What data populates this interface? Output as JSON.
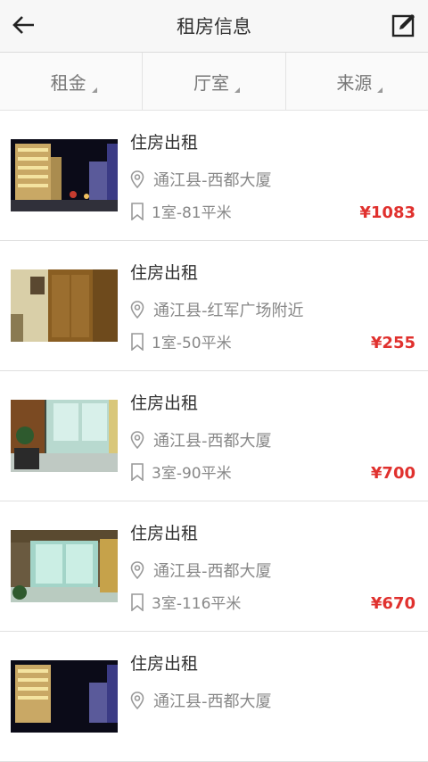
{
  "header": {
    "title": "租房信息"
  },
  "filters": [
    {
      "label": "租金"
    },
    {
      "label": "厅室"
    },
    {
      "label": "来源"
    }
  ],
  "listings": [
    {
      "title": "住房出租",
      "location": "通江县-西都大厦",
      "size": "1室-81平米",
      "price": "¥1083",
      "photo": "night-building"
    },
    {
      "title": "住房出租",
      "location": "通江县-红军广场附近",
      "size": "1室-50平米",
      "price": "¥255",
      "photo": "room-wood"
    },
    {
      "title": "住房出租",
      "location": "通江县-西都大厦",
      "size": "3室-90平米",
      "price": "¥700",
      "photo": "room-window-teal"
    },
    {
      "title": "住房出租",
      "location": "通江县-西都大厦",
      "size": "3室-116平米",
      "price": "¥670",
      "photo": "room-window-teal-2"
    },
    {
      "title": "住房出租",
      "location": "通江县-西都大厦",
      "size": "",
      "price": "",
      "photo": "night-building"
    }
  ],
  "colors": {
    "price": "#e0312e",
    "text": "#333333",
    "muted": "#888888"
  }
}
